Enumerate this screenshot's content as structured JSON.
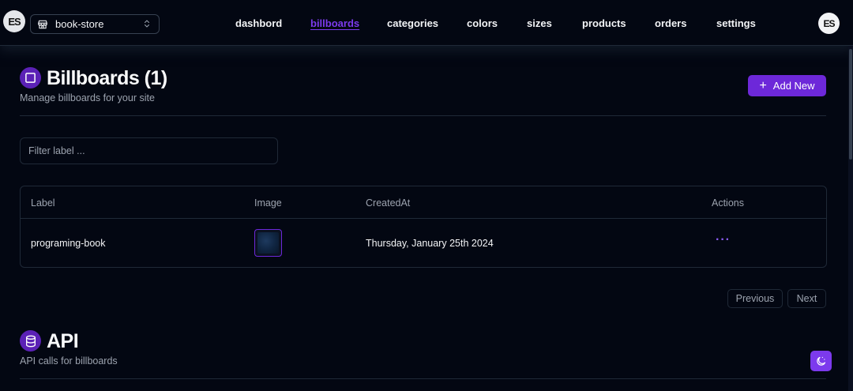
{
  "header": {
    "logo_text": "ES",
    "store": "book-store",
    "nav": [
      "dashbord",
      "billboards",
      "categories",
      "colors",
      "sizes",
      "products",
      "orders",
      "settings"
    ],
    "active_nav": "billboards",
    "avatar_text": "ES"
  },
  "billboards": {
    "title": "Billboards (1)",
    "subtitle": "Manage billboards for your site",
    "add_label": "Add New",
    "filter_placeholder": "Filter label ...",
    "columns": [
      "Label",
      "Image",
      "CreatedAt",
      "Actions"
    ],
    "rows": [
      {
        "label": "programing-book",
        "created_at": "Thursday, January 25th 2024",
        "actions": "···"
      }
    ]
  },
  "pagination": {
    "previous": "Previous",
    "next": "Next"
  },
  "api": {
    "title": "API",
    "subtitle": "API calls for billboards"
  },
  "colors": {
    "accent": "#7c3aed",
    "background": "#030712"
  }
}
